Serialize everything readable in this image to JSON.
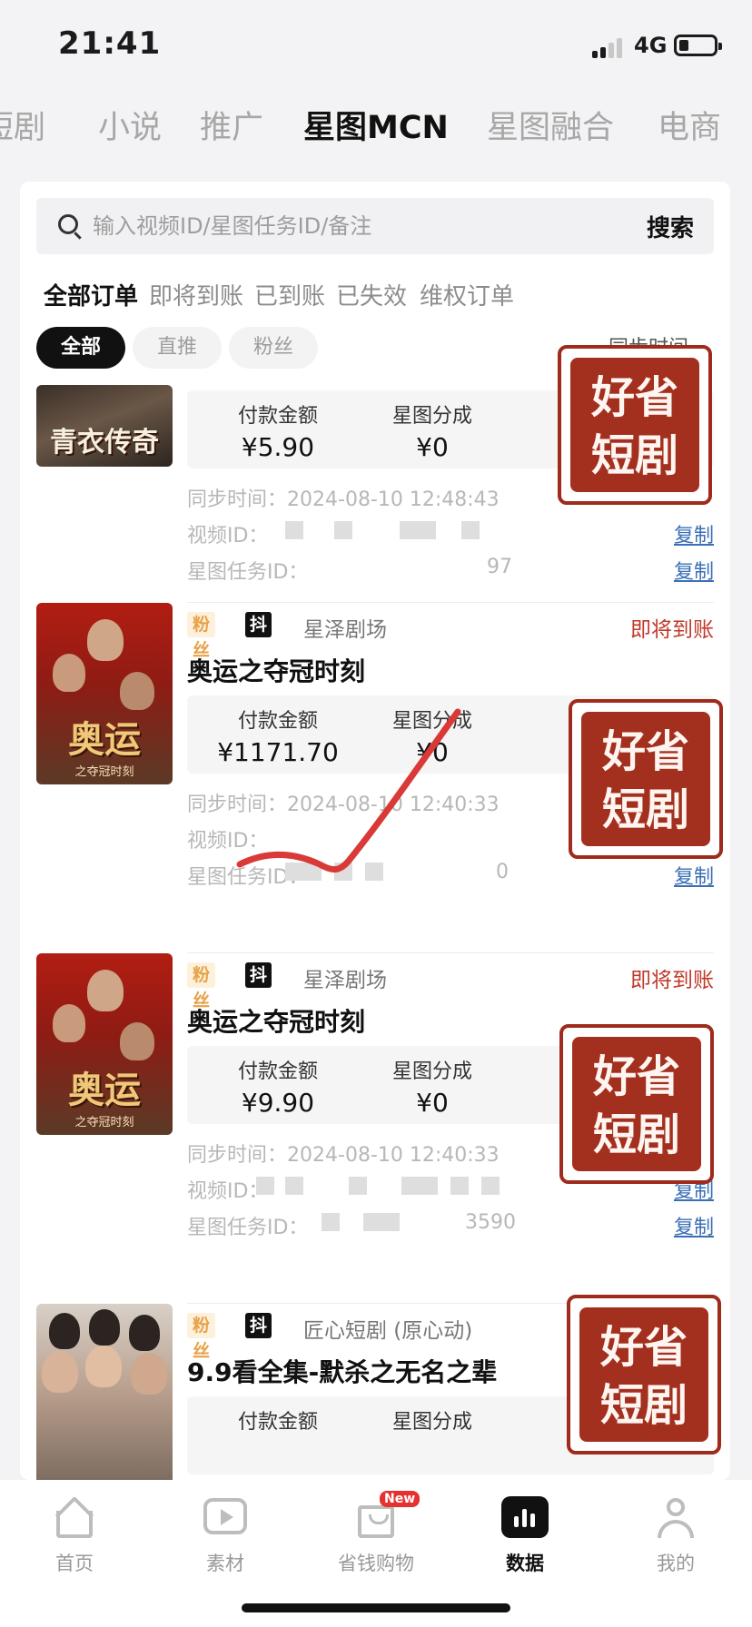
{
  "status_bar": {
    "time": "21:41",
    "network": "4G"
  },
  "categories": [
    {
      "label": "短剧",
      "active": false
    },
    {
      "label": "小说",
      "active": false
    },
    {
      "label": "推广",
      "active": false
    },
    {
      "label": "星图MCN",
      "active": true
    },
    {
      "label": "星图融合",
      "active": false
    },
    {
      "label": "电商",
      "active": false
    }
  ],
  "search": {
    "placeholder": "输入视频ID/星图任务ID/备注",
    "button": "搜索"
  },
  "status_tabs": [
    "全部订单",
    "即将到账",
    "已到账",
    "已失效",
    "维权订单"
  ],
  "filter_chips": [
    "全部",
    "直推",
    "粉丝"
  ],
  "sort_label": "同步时间",
  "orders": [
    {
      "thumb_title": "青衣传奇",
      "amount_label": "付款金额",
      "amount": "¥5.90",
      "share_label": "星图分成",
      "share": "¥0",
      "sync_label": "同步时间：",
      "sync_time": "2024-08-10 12:48:43",
      "video_label": "视频ID：",
      "task_label": "星图任务ID：",
      "task_tail": "97",
      "copy": "复制"
    },
    {
      "tag_fans": "粉丝",
      "tag_platform": "抖音",
      "studio": "星泽剧场",
      "status": "即将到账",
      "title": "奥运之夺冠时刻",
      "thumb_title": "奥运",
      "thumb_sub": "之夺冠时刻",
      "amount_label": "付款金额",
      "amount": "¥1171.70",
      "share_label": "星图分成",
      "share": "¥0",
      "sync_label": "同步时间：",
      "sync_time": "2024-08-10 12:40:33",
      "video_label": "视频ID：",
      "task_label": "星图任务ID：",
      "task_tail": "0",
      "copy": "复制"
    },
    {
      "tag_fans": "粉丝",
      "tag_platform": "抖音",
      "studio": "星泽剧场",
      "status": "即将到账",
      "title": "奥运之夺冠时刻",
      "thumb_title": "奥运",
      "thumb_sub": "之夺冠时刻",
      "amount_label": "付款金额",
      "amount": "¥9.90",
      "share_label": "星图分成",
      "share": "¥0",
      "sync_label": "同步时间：",
      "sync_time": "2024-08-10 12:40:33",
      "video_label": "视频ID：",
      "task_label": "星图任务ID：",
      "task_tail": "3590",
      "copy": "复制"
    },
    {
      "tag_fans": "粉丝",
      "tag_platform": "抖音",
      "studio": "匠心短剧 (原心动)",
      "title": "9.9看全集-默杀之无名之辈",
      "amount_label": "付款金额",
      "share_label": "星图分成"
    }
  ],
  "watermark": {
    "line1": "好省",
    "line2": "短剧"
  },
  "bottom_nav": [
    {
      "label": "首页",
      "icon": "home-icon",
      "active": false
    },
    {
      "label": "素材",
      "icon": "play-icon",
      "active": false
    },
    {
      "label": "省钱购物",
      "icon": "shopping-bag-icon",
      "badge": "New",
      "active": false
    },
    {
      "label": "数据",
      "icon": "data-chart-icon",
      "active": true
    },
    {
      "label": "我的",
      "icon": "user-icon",
      "active": false
    }
  ],
  "colors": {
    "accent_red": "#c0392b",
    "link_blue": "#3a6fb6",
    "watermark_red": "#a3301f",
    "badge_red": "#e6322e"
  }
}
